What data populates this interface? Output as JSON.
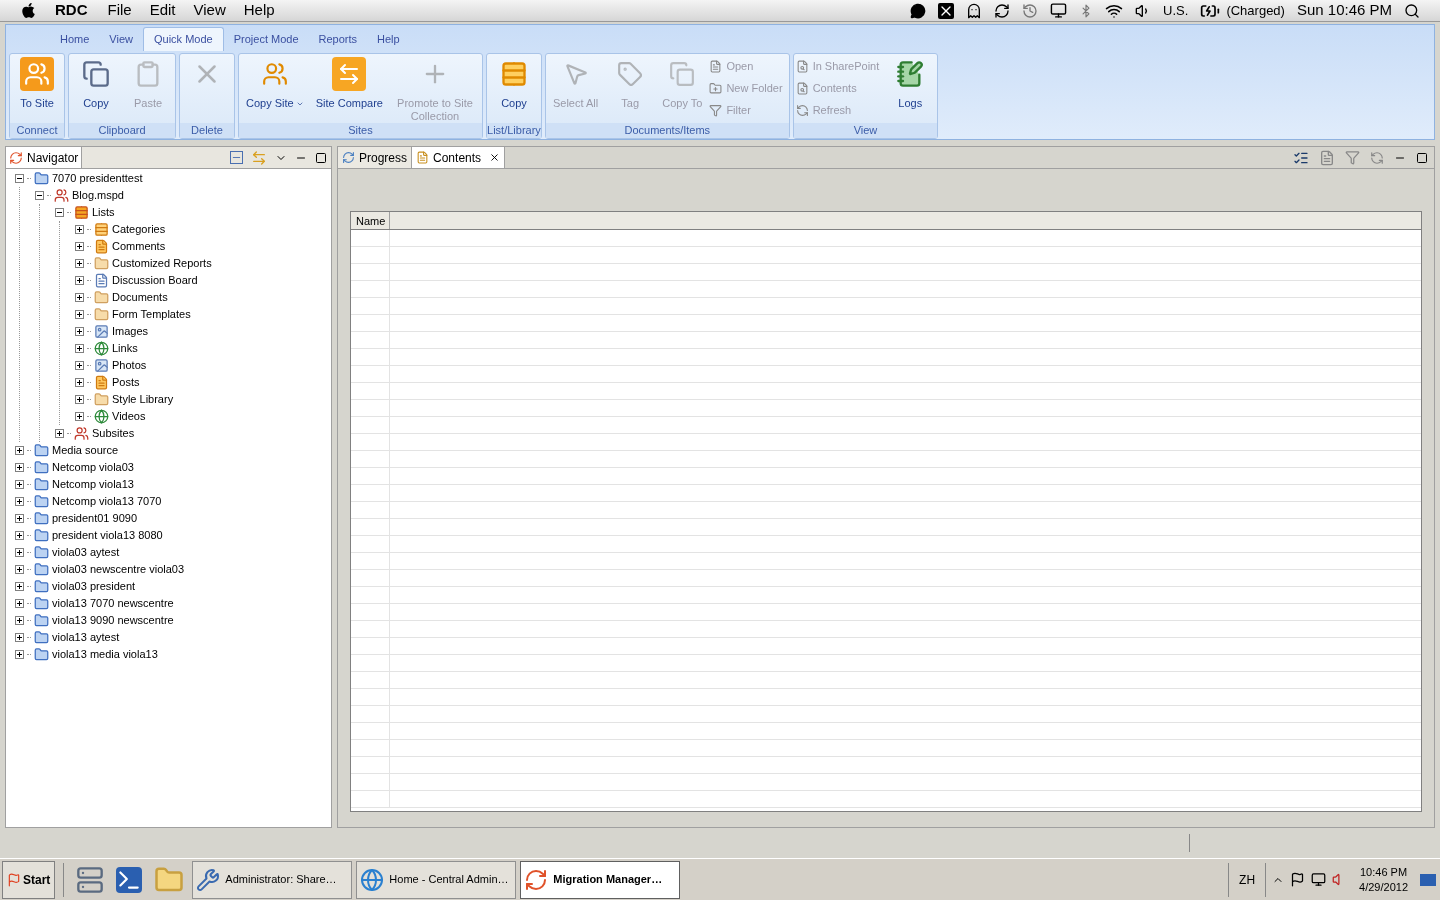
{
  "menubar": {
    "app": "RDC",
    "menus": [
      "File",
      "Edit",
      "View",
      "Help"
    ],
    "keyboard": "U.S.",
    "battery": "(Charged)",
    "clock": "Sun 10:46 PM"
  },
  "ribbon": {
    "tabs": [
      {
        "label": "Home",
        "selected": false
      },
      {
        "label": "View",
        "selected": false
      },
      {
        "label": "Quick Mode",
        "selected": true
      },
      {
        "label": "Project Mode",
        "selected": false
      },
      {
        "label": "Reports",
        "selected": false
      },
      {
        "label": "Help",
        "selected": false
      }
    ],
    "groups": [
      {
        "label": "Connect",
        "items": [
          {
            "kind": "large",
            "label": "To Site",
            "disabled": false
          }
        ]
      },
      {
        "label": "Clipboard",
        "items": [
          {
            "kind": "large",
            "label": "Copy",
            "disabled": false
          },
          {
            "kind": "large",
            "label": "Paste",
            "disabled": true
          }
        ]
      },
      {
        "label": "Delete",
        "items": [
          {
            "kind": "large",
            "disabled": true
          }
        ]
      },
      {
        "label": "Sites",
        "items": [
          {
            "kind": "large",
            "label": "Copy Site",
            "dropdown": true,
            "disabled": false
          },
          {
            "kind": "large",
            "label": "Site Compare",
            "disabled": false
          },
          {
            "kind": "large",
            "label": "Promote to Site Collection",
            "disabled": true
          }
        ]
      },
      {
        "label": "List/Library",
        "items": [
          {
            "kind": "large",
            "label": "Copy",
            "disabled": false
          }
        ]
      },
      {
        "label": "Documents/Items",
        "items": [
          {
            "kind": "large",
            "label": "Select All",
            "disabled": true
          },
          {
            "kind": "large",
            "label": "Tag",
            "disabled": true
          },
          {
            "kind": "large",
            "label": "Copy To",
            "disabled": true
          },
          {
            "kind": "small",
            "label": "Open",
            "disabled": true
          },
          {
            "kind": "small",
            "label": "New Folder",
            "disabled": true
          },
          {
            "kind": "small",
            "label": "Filter",
            "disabled": true
          }
        ]
      },
      {
        "label": "View",
        "items": [
          {
            "kind": "small",
            "label": "In SharePoint",
            "disabled": true
          },
          {
            "kind": "small",
            "label": "Contents",
            "disabled": true
          },
          {
            "kind": "small",
            "label": "Refresh",
            "disabled": true
          },
          {
            "kind": "large",
            "label": "Logs",
            "disabled": false
          }
        ]
      }
    ]
  },
  "navigator": {
    "title": "Navigator",
    "tree": [
      {
        "label": "7070 presidenttest",
        "kind": "server",
        "expanded": true,
        "children": [
          {
            "label": "Blog.mspd",
            "kind": "site",
            "expanded": true,
            "children": [
              {
                "label": "Lists",
                "kind": "lists",
                "expanded": true,
                "children": [
                  {
                    "label": "Categories",
                    "kind": "list",
                    "expanded": false
                  },
                  {
                    "label": "Comments",
                    "kind": "comments",
                    "expanded": false
                  },
                  {
                    "label": "Customized Reports",
                    "kind": "library",
                    "expanded": false
                  },
                  {
                    "label": "Discussion Board",
                    "kind": "discussion",
                    "expanded": false
                  },
                  {
                    "label": "Documents",
                    "kind": "library",
                    "expanded": false
                  },
                  {
                    "label": "Form Templates",
                    "kind": "library",
                    "expanded": false
                  },
                  {
                    "label": "Images",
                    "kind": "pictures",
                    "expanded": false
                  },
                  {
                    "label": "Links",
                    "kind": "links",
                    "expanded": false
                  },
                  {
                    "label": "Photos",
                    "kind": "pictures",
                    "expanded": false
                  },
                  {
                    "label": "Posts",
                    "kind": "posts",
                    "expanded": false
                  },
                  {
                    "label": "Style Library",
                    "kind": "library",
                    "expanded": false
                  },
                  {
                    "label": "Videos",
                    "kind": "links",
                    "expanded": false
                  }
                ]
              },
              {
                "label": "Subsites",
                "kind": "site",
                "expanded": false
              }
            ]
          }
        ]
      },
      {
        "label": "Media source",
        "kind": "server",
        "expanded": false
      },
      {
        "label": "Netcomp viola03",
        "kind": "server",
        "expanded": false
      },
      {
        "label": "Netcomp viola13",
        "kind": "server",
        "expanded": false
      },
      {
        "label": "Netcomp viola13 7070",
        "kind": "server",
        "expanded": false
      },
      {
        "label": "president01 9090",
        "kind": "server",
        "expanded": false
      },
      {
        "label": "president viola13 8080",
        "kind": "server",
        "expanded": false
      },
      {
        "label": "viola03 aytest",
        "kind": "server",
        "expanded": false
      },
      {
        "label": "viola03 newscentre viola03",
        "kind": "server",
        "expanded": false
      },
      {
        "label": "viola03 president",
        "kind": "server",
        "expanded": false
      },
      {
        "label": "viola13 7070 newscentre",
        "kind": "server",
        "expanded": false
      },
      {
        "label": "viola13 9090 newscentre",
        "kind": "server",
        "expanded": false
      },
      {
        "label": "viola13 aytest",
        "kind": "server",
        "expanded": false
      },
      {
        "label": "viola13 media viola13",
        "kind": "server",
        "expanded": false
      }
    ]
  },
  "editor": {
    "tabs": [
      {
        "label": "Progress",
        "selected": false,
        "closable": false
      },
      {
        "label": "Contents",
        "selected": true,
        "closable": true
      }
    ],
    "table": {
      "columns": [
        "Name"
      ]
    }
  },
  "taskbar": {
    "start": "Start",
    "tasks": [
      {
        "label": "Administrator: Share…",
        "selected": false
      },
      {
        "label": "Home - Central Admin…",
        "selected": false
      },
      {
        "label": "Migration Manager…",
        "selected": true
      }
    ],
    "language": "ZH",
    "time": "10:46 PM",
    "date": "4/29/2012"
  }
}
